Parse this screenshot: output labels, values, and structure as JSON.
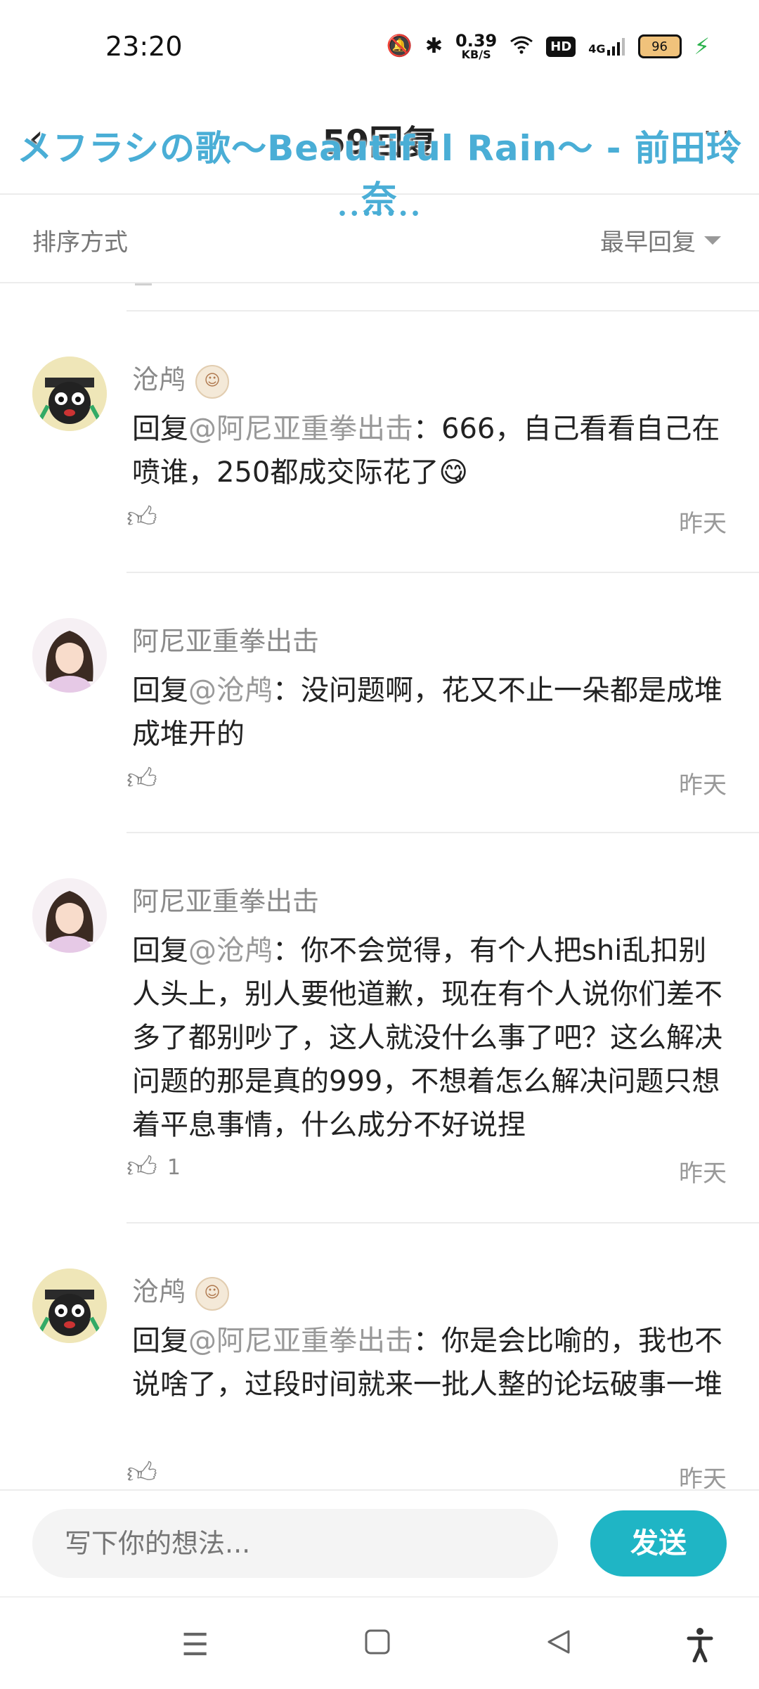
{
  "status_bar": {
    "time": "23:20",
    "mute_icon": "bell-off-icon",
    "bluetooth_icon": "bluetooth-icon",
    "net_speed_value": "0.39",
    "net_speed_unit": "KB/S",
    "wifi_icon": "wifi-icon",
    "hd_label": "HD",
    "signal_label": "4G",
    "battery_level": "96",
    "charging_icon": "bolt-icon"
  },
  "header": {
    "title": "59回复",
    "song_overlay": "メフラシの歌～Beautiful Rain～ - 前田玲奈",
    "back_icon": "back-arrow-icon",
    "overflow_icon": "overflow-icon",
    "dots": "•••••••"
  },
  "sort_bar": {
    "label": "排序方式",
    "value": "最早回复"
  },
  "comments": [
    {
      "author": "沧鸬",
      "reply_prefix": "回复",
      "mention": "@阿尼亚重拳出击",
      "text": "：666，自己看看自己在喷谁，250都成交际花了😋",
      "likes": "",
      "time": "昨天"
    },
    {
      "author": "阿尼亚重拳出击",
      "reply_prefix": "回复",
      "mention": "@沧鸬",
      "text": "：没问题啊，花又不止一朵都是成堆成堆开的",
      "likes": "",
      "time": "昨天"
    },
    {
      "author": "阿尼亚重拳出击",
      "reply_prefix": "回复",
      "mention": "@沧鸬",
      "text": "：你不会觉得，有个人把shi乱扣别人头上，别人要他道歉，现在有个人说你们差不多了都别吵了，这人就没什么事了吧？这么解决问题的那是真的999，不想着怎么解决问题只想着平息事情，什么成分不好说捏",
      "likes": "1",
      "time": "昨天"
    },
    {
      "author": "沧鸬",
      "reply_prefix": "回复",
      "mention": "@阿尼亚重拳出击",
      "text": "：你是会比喻的，我也不说啥了，过段时间就来一批人整的论坛破事一堆",
      "likes": "",
      "time": "昨天"
    }
  ],
  "input": {
    "placeholder": "写下你的想法...",
    "send_label": "发送"
  },
  "nav": {
    "menu_icon": "menu-icon",
    "home_icon": "square-home-icon",
    "back_icon": "triangle-back-icon",
    "accessibility_icon": "accessibility-icon"
  },
  "colors": {
    "accent": "#1fb5c5",
    "overlay_text": "#4aaed6",
    "muted_text": "#8a8a8a"
  }
}
